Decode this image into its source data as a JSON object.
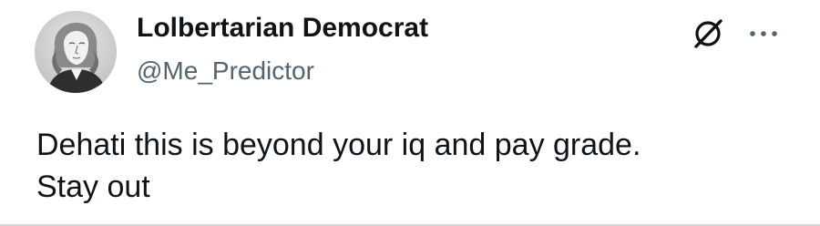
{
  "author": {
    "display_name": "Lolbertarian Democrat",
    "handle": "@Me_Predictor",
    "avatar_icon": "portrait-engraving-avatar"
  },
  "actions": {
    "grok_icon": "slashed-circle-icon",
    "more_icon": "more-dots-icon"
  },
  "tweet": {
    "lines": [
      "Dehati this is beyond your iq and pay grade.",
      "Stay out"
    ]
  },
  "colors": {
    "name": "#0f1419",
    "handle": "#536471",
    "text": "#0f1419",
    "background": "#ffffff"
  }
}
